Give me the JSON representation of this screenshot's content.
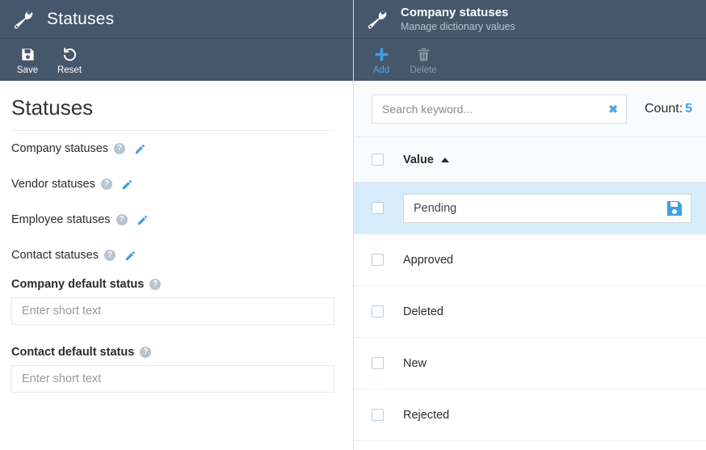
{
  "left": {
    "header": {
      "icon": "wrench-icon",
      "title": "Statuses"
    },
    "toolbar": [
      {
        "id": "save",
        "label": "Save",
        "icon": "floppy-disk-icon",
        "state": "enabled"
      },
      {
        "id": "reset",
        "label": "Reset",
        "icon": "undo-arrow-icon",
        "state": "enabled"
      }
    ],
    "page_title": "Statuses",
    "status_rows": [
      {
        "label": "Company statuses",
        "help": "?",
        "edit_icon": "pencil-icon"
      },
      {
        "label": "Vendor statuses",
        "help": "?",
        "edit_icon": "pencil-icon"
      },
      {
        "label": "Employee statuses",
        "help": "?",
        "edit_icon": "pencil-icon"
      },
      {
        "label": "Contact statuses",
        "help": "?",
        "edit_icon": "pencil-icon"
      }
    ],
    "fields": [
      {
        "label": "Company default status",
        "help": "?",
        "value": "",
        "placeholder": "Enter short text"
      },
      {
        "label": "Contact default status",
        "help": "?",
        "value": "",
        "placeholder": "Enter short text"
      }
    ]
  },
  "right": {
    "header": {
      "icon": "wrench-icon",
      "title": "Company statuses",
      "subtitle": "Manage dictionary values"
    },
    "toolbar": [
      {
        "id": "add",
        "label": "Add",
        "icon": "plus-icon",
        "state": "enabled"
      },
      {
        "id": "delete",
        "label": "Delete",
        "icon": "trash-icon",
        "state": "disabled"
      }
    ],
    "search": {
      "value": "",
      "placeholder": "Search keyword...",
      "clear_icon": "clear-x-icon"
    },
    "count": {
      "label": "Count:",
      "value": "5"
    },
    "grid": {
      "column_header": {
        "label": "Value",
        "sort": "asc",
        "sort_icon": "caret-up-icon"
      },
      "rows": [
        {
          "value": "Pending",
          "editing": true,
          "save_icon": "floppy-disk-icon",
          "checked": false
        },
        {
          "value": "Approved",
          "editing": false,
          "checked": false
        },
        {
          "value": "Deleted",
          "editing": false,
          "checked": false
        },
        {
          "value": "New",
          "editing": false,
          "checked": false
        },
        {
          "value": "Rejected",
          "editing": false,
          "checked": false
        }
      ]
    }
  },
  "colors": {
    "header_bg": "#46566b",
    "accent_blue": "#4fa8e0",
    "row_highlight": "#d6ecfa",
    "help_gray": "#b8c4d0"
  }
}
